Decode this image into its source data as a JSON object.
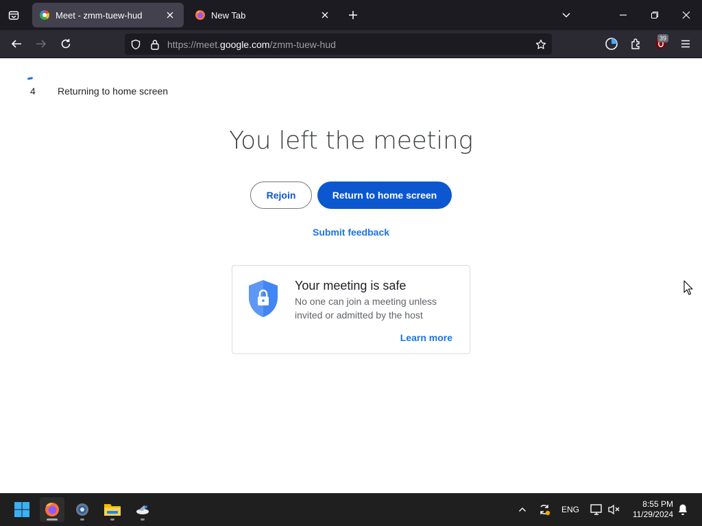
{
  "browser": {
    "tabs": [
      {
        "title": "Meet - zmm-tuew-hud",
        "active": true
      },
      {
        "title": "New Tab",
        "active": false
      }
    ],
    "url": {
      "prefix": "https://meet.",
      "domain": "google.com",
      "path": "/zmm-tuew-hud"
    },
    "extension_badge": "39"
  },
  "page": {
    "countdown_number": "4",
    "countdown_text": "Returning to home screen",
    "headline": "You left the meeting",
    "rejoin_label": "Rejoin",
    "return_home_label": "Return to home screen",
    "submit_feedback_label": "Submit feedback",
    "safety_card": {
      "title": "Your meeting is safe",
      "description": "No one can join a meeting unless invited or admitted by the host",
      "learn_more_label": "Learn more"
    }
  },
  "taskbar": {
    "apps": [
      "windows-start",
      "firefox",
      "settings",
      "file-explorer",
      "app"
    ],
    "language": "ENG",
    "time": "8:55 PM",
    "date": "11/29/2024"
  },
  "colors": {
    "primary_button": "#0b57d0",
    "link": "#1a73e8",
    "browser_chrome": "#1c1b22"
  }
}
